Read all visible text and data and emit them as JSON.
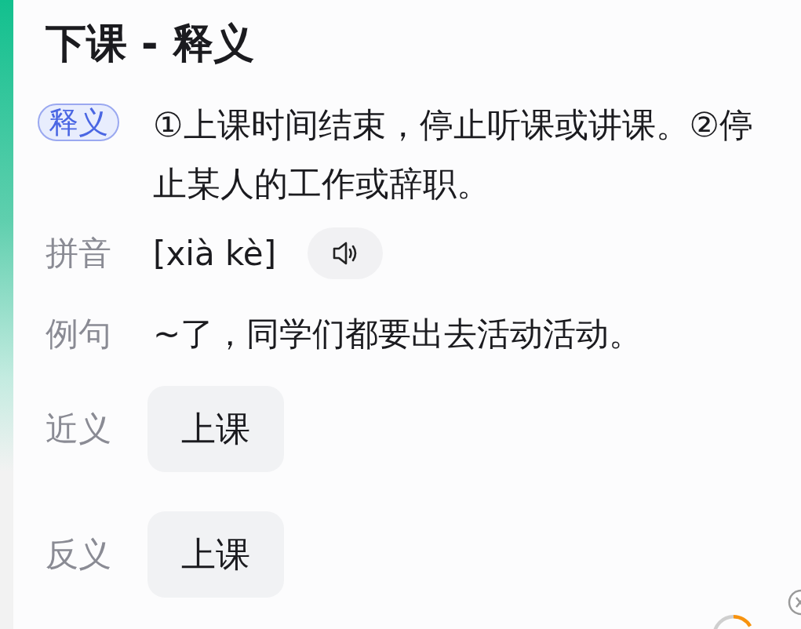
{
  "title": "下课 - 释义",
  "definition": {
    "badge": "释义",
    "text": "①上课时间结束，停止听课或讲课。②停止某人的工作或辞职。"
  },
  "pinyin": {
    "label": "拼音",
    "text": "[xià kè]"
  },
  "example": {
    "label": "例句",
    "text": "~了，同学们都要出去活动活动。"
  },
  "synonyms": {
    "label": "近义",
    "words": [
      "上课"
    ]
  },
  "antonyms": {
    "label": "反义",
    "words": [
      "上课"
    ]
  }
}
